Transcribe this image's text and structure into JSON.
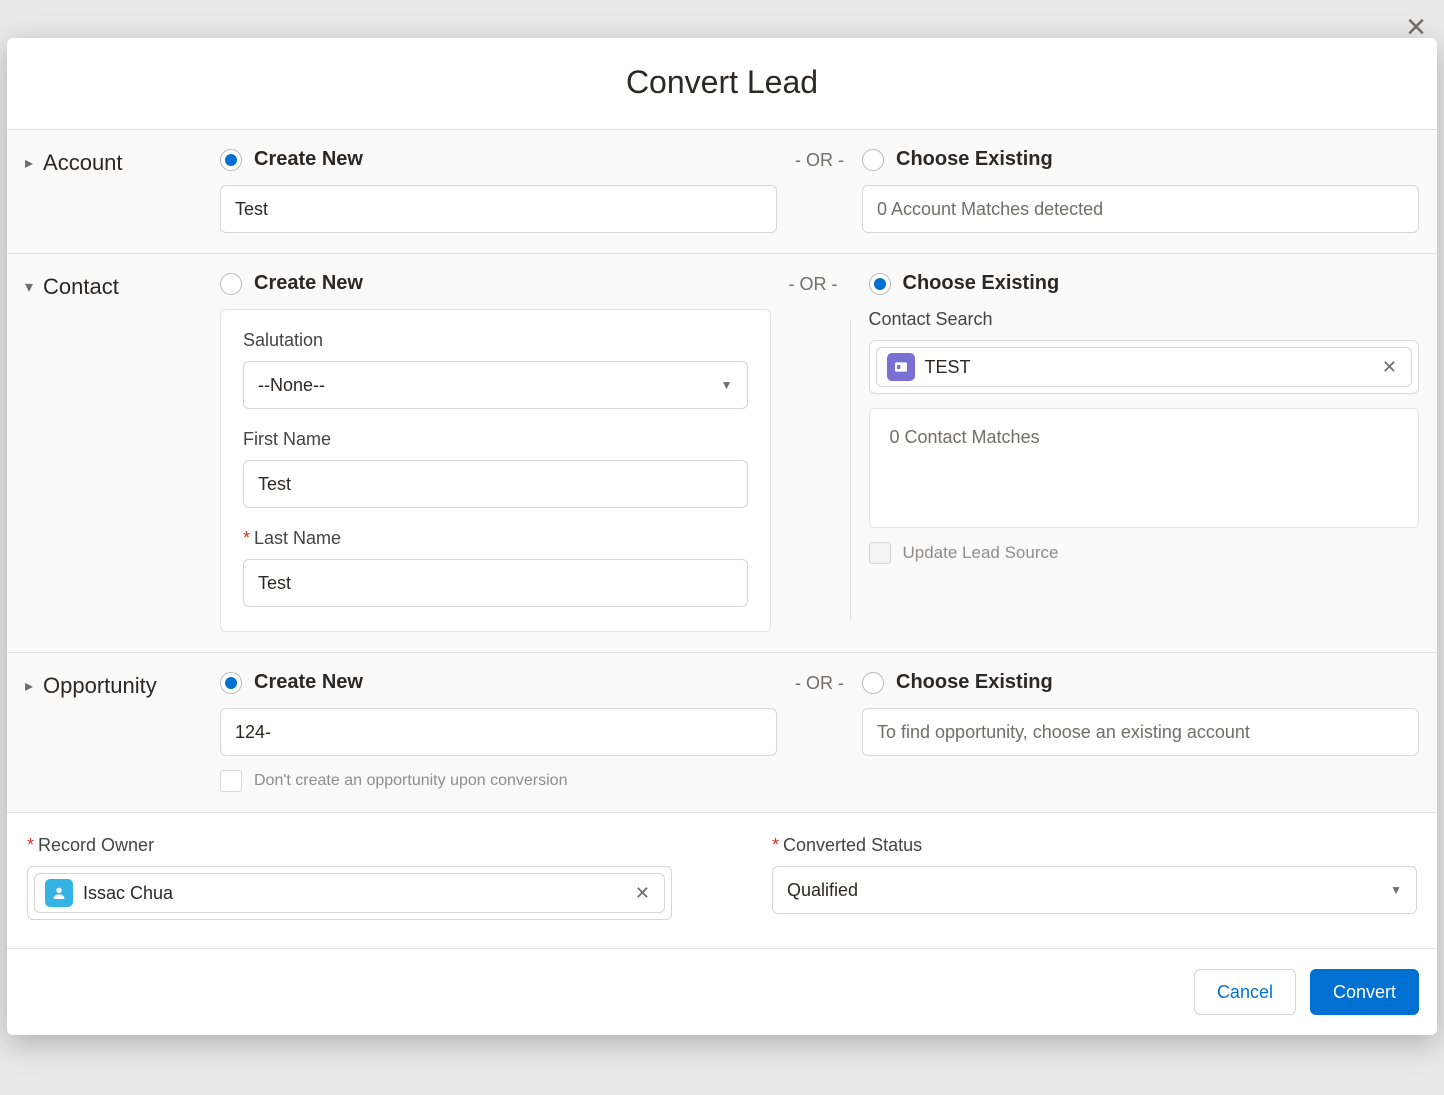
{
  "modal": {
    "title": "Convert Lead",
    "close": "×"
  },
  "labels": {
    "create_new": "Create New",
    "choose_existing": "Choose Existing",
    "or": "- OR -"
  },
  "account": {
    "heading": "Account",
    "name_value": "Test",
    "matches_text": "0 Account Matches detected"
  },
  "contact": {
    "heading": "Contact",
    "salutation_label": "Salutation",
    "salutation_value": "--None--",
    "first_name_label": "First Name",
    "first_name_value": "Test",
    "last_name_label": "Last Name",
    "last_name_value": "Test",
    "search_label": "Contact Search",
    "search_pill": "TEST",
    "matches_text": "0 Contact Matches",
    "update_source_label": "Update Lead Source"
  },
  "opportunity": {
    "heading": "Opportunity",
    "name_value": "124-",
    "dont_create_label": "Don't create an opportunity upon conversion",
    "existing_hint": "To find opportunity, choose an existing account"
  },
  "owner": {
    "record_owner_label": "Record Owner",
    "record_owner_value": "Issac Chua",
    "converted_status_label": "Converted Status",
    "converted_status_value": "Qualified"
  },
  "footer": {
    "cancel": "Cancel",
    "convert": "Convert"
  }
}
